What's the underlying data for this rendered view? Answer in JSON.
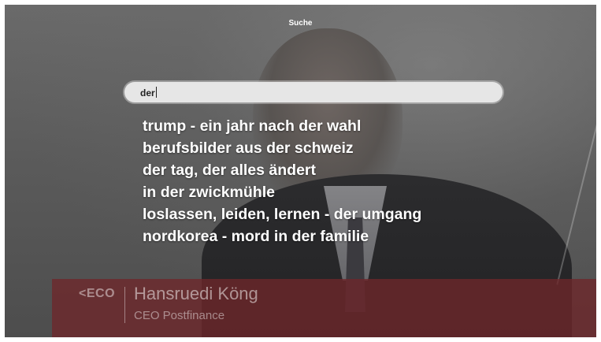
{
  "search": {
    "title": "Suche",
    "query": "der"
  },
  "suggestions": [
    "trump - ein jahr nach der wahl",
    "berufsbilder aus der schweiz",
    "der tag, der alles ändert",
    "in der zwickmühle",
    "loslassen, leiden, lernen - der umgang",
    "nordkorea - mord in der familie"
  ],
  "lower_third": {
    "logo": "ECO",
    "name": "Hansruedi Köng",
    "title": "CEO Postfinance"
  },
  "colors": {
    "banner": "#6e262a",
    "field": "#e6e6e6",
    "text": "#ffffff"
  }
}
